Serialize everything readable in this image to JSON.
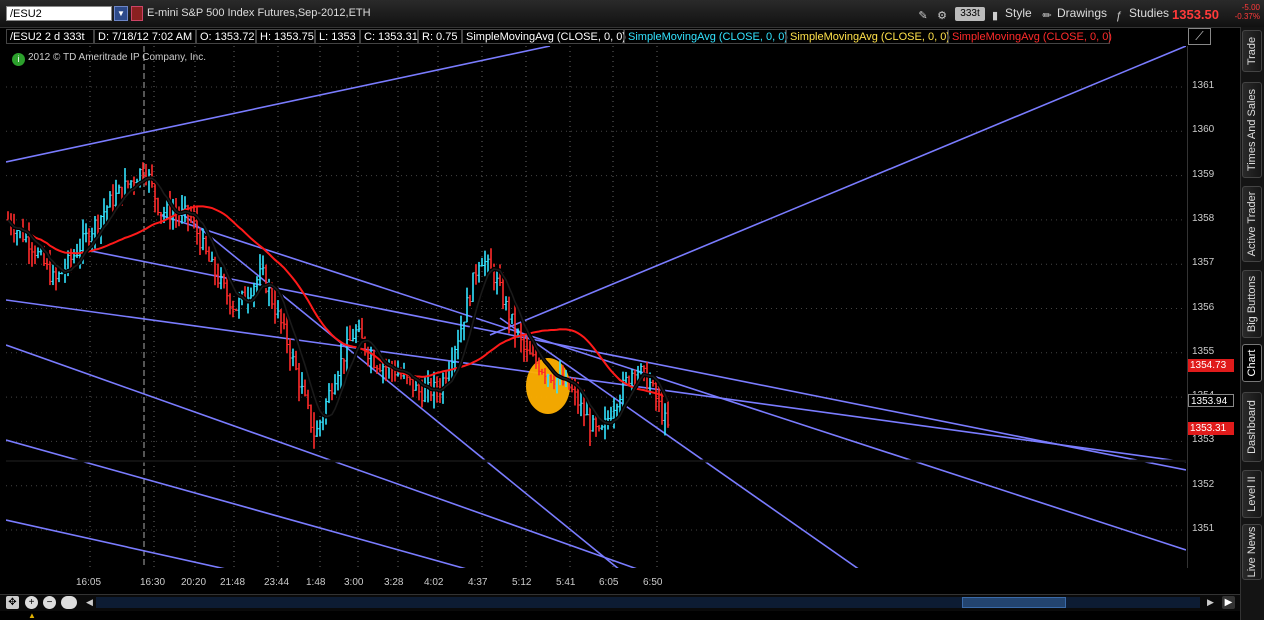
{
  "header": {
    "symbol": "/ESU2",
    "description": "E-mini S&P 500 Index Futures,Sep-2012,ETH",
    "aggregation": "333t",
    "style_label": "Style",
    "drawings_label": "Drawings",
    "studies_label": "Studies",
    "last_price": "1353.50",
    "change": "-5.00",
    "change_pct": "-0.37%"
  },
  "infobar": {
    "symbol_agg": "/ESU2 2 d 333t",
    "date": "D: 7/18/12 7:02 AM",
    "open": "O: 1353.72",
    "high": "H: 1353.75",
    "low": "L: 1353",
    "close": "C: 1353.31",
    "range": "R: 0.75",
    "studies": [
      {
        "label": "SimpleMovingAvg (CLOSE, 0, 0)",
        "color": "#ffffff"
      },
      {
        "label": "SimpleMovingAvg (CLOSE, 0, 0)",
        "color": "#33e3ff"
      },
      {
        "label": "SimpleMovingAvg (CLOSE, 0, 0)",
        "color": "#ffe14a"
      },
      {
        "label": "SimpleMovingAvg (CLOSE, 0, 0)",
        "color": "#ff2a2a"
      }
    ]
  },
  "copyright": "2012 © TD Ameritrade IP Company, Inc.",
  "yaxis": {
    "labels": [
      "1361",
      "1360",
      "1359",
      "1358",
      "1357",
      "1356",
      "1355",
      "1354",
      "1353",
      "1352",
      "1351"
    ],
    "tags": [
      {
        "value": "1354.73",
        "bg": "#e01b1b",
        "fg": "#ffffff"
      },
      {
        "value": "1353.94",
        "bg": "#000000",
        "fg": "#ffffff"
      },
      {
        "value": "1353.31",
        "bg": "#e01b1b",
        "fg": "#ffffff"
      }
    ]
  },
  "xaxis": {
    "labels": [
      "16:05",
      "16:30",
      "20:20",
      "21:48",
      "23:44",
      "1:48",
      "3:00",
      "3:28",
      "4:02",
      "4:37",
      "5:12",
      "5:41",
      "6:05",
      "6:50"
    ]
  },
  "sidebar": {
    "tabs": [
      "Trade",
      "Times And Sales",
      "Active Trader",
      "Big Buttons",
      "Chart",
      "Dashboard",
      "Level II",
      "Live News"
    ],
    "active": "Chart"
  },
  "colors": {
    "up_bar": "#33e3ff",
    "down_bar": "#ff2a2a",
    "trendline": "#7a7cff",
    "sma_black": "#000000",
    "sma_red": "#ff1a1a",
    "highlight": "#ffb000"
  }
}
